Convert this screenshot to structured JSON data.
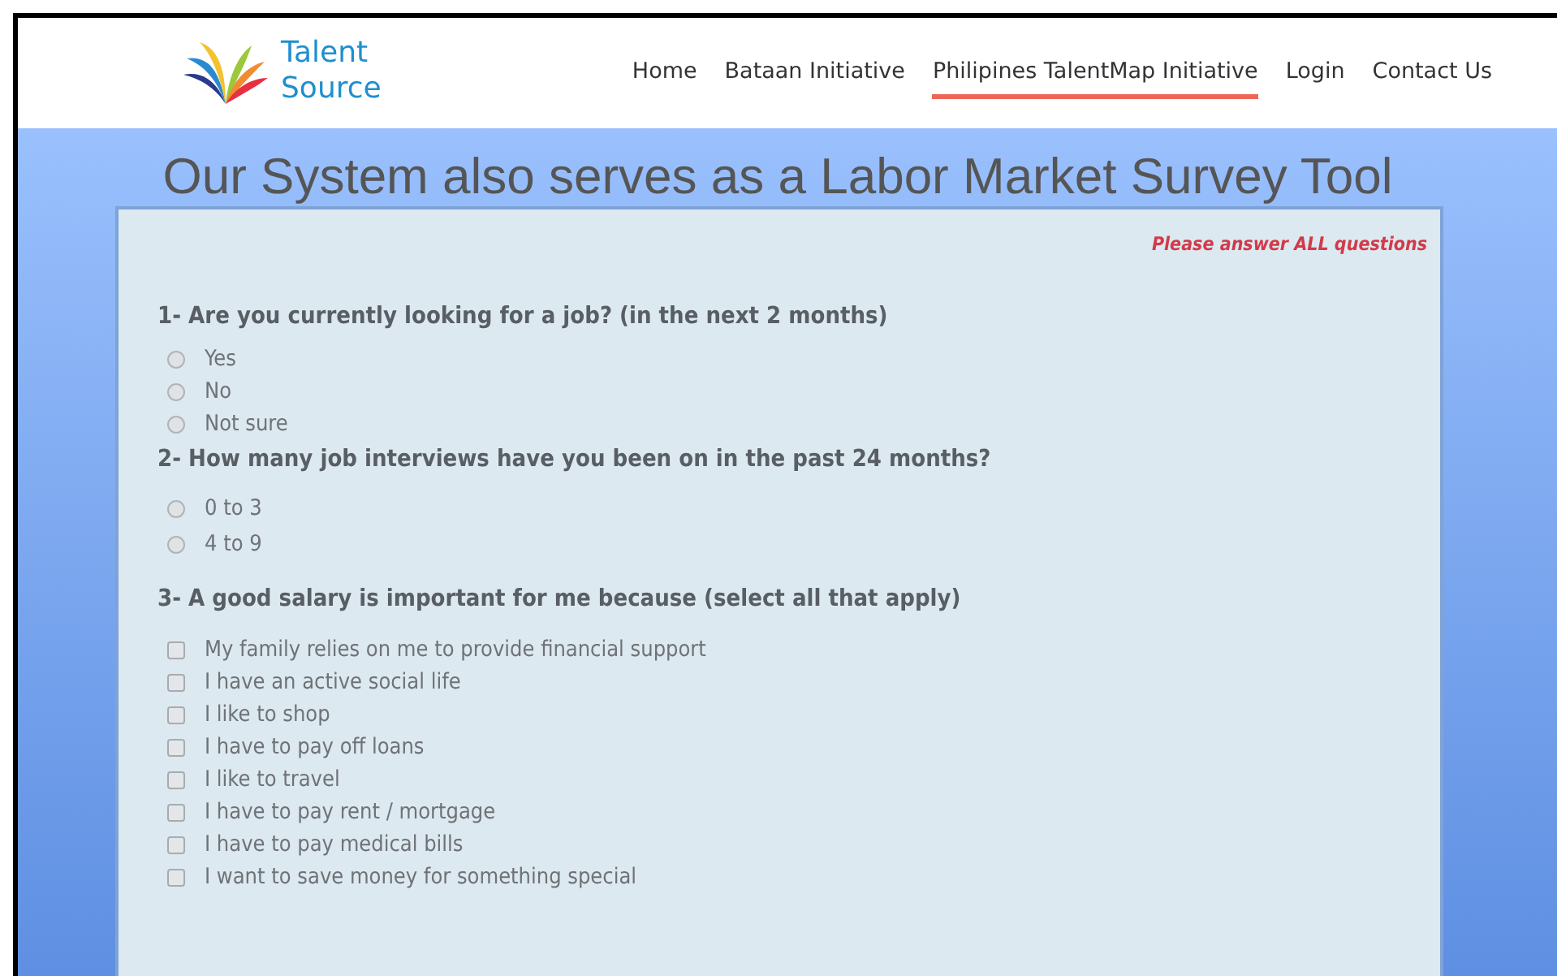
{
  "header": {
    "logo": {
      "line_1": "Talent",
      "line_2": "Source"
    },
    "nav": [
      {
        "label": "Home",
        "selected": false
      },
      {
        "label": "Bataan Initiative",
        "selected": false
      },
      {
        "label": "Philipines TalentMap Initiative",
        "selected": true
      },
      {
        "label": "Login",
        "selected": false
      },
      {
        "label": "Contact Us",
        "selected": false
      }
    ]
  },
  "title": "Our System also serves as a Labor Market Survey Tool",
  "survey": {
    "notice": "Please answer ALL questions",
    "questions": [
      {
        "text": "1- Are you currently looking for a job? (in the next 2 months)",
        "kind": "radio",
        "options": [
          {
            "label": "Yes",
            "checked": false
          },
          {
            "label": "No",
            "checked": false
          },
          {
            "label": "Not sure",
            "checked": false
          }
        ]
      },
      {
        "text": "2- How many job interviews have you been on in the past 24 months?",
        "kind": "radio",
        "options": [
          {
            "label": "0 to 3",
            "checked": false
          },
          {
            "label": "4 to 9",
            "checked": false
          }
        ]
      },
      {
        "text": "3- A good salary is important for me because (select all that apply)",
        "kind": "checkbox",
        "options": [
          {
            "label": "My family relies on me to provide financial support",
            "checked": false
          },
          {
            "label": "I have an active social life",
            "checked": false
          },
          {
            "label": "I like to shop",
            "checked": false
          },
          {
            "label": "I have to pay off loans",
            "checked": false
          },
          {
            "label": "I like to travel",
            "checked": false
          },
          {
            "label": "I have to pay rent / mortgage",
            "checked": false
          },
          {
            "label": "I have to pay medical bills",
            "checked": false
          },
          {
            "label": "I want to save money for something special",
            "checked": false
          }
        ]
      }
    ]
  }
}
